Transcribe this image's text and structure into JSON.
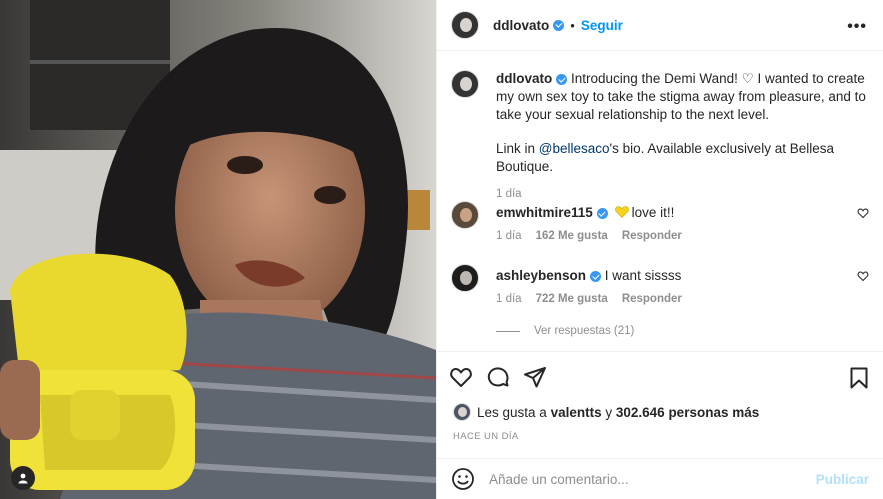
{
  "post": {
    "author": "ddlovato",
    "follow_label": "Seguir",
    "separator": "•",
    "caption_text": "Introducing the Demi Wand! ♡ I wanted to create my own sex toy to take the stigma away from pleasure, and to take your sexual relationship to the next level.",
    "caption_link_prefix": "Link in ",
    "caption_mention": "@bellesaco",
    "caption_link_suffix": "'s bio. Available exclusively at Bellesa Boutique.",
    "caption_time": "1 día"
  },
  "comments": [
    {
      "user": "emwhitmire115",
      "text": "love it!!",
      "emoji": "yellow-heart",
      "time": "1 día",
      "likes": "162 Me gusta",
      "reply": "Responder"
    },
    {
      "user": "ashleybenson",
      "text": "I want sissss",
      "time": "1 día",
      "likes": "722 Me gusta",
      "reply": "Responder"
    }
  ],
  "view_replies": "Ver respuestas (21)",
  "likes_line": {
    "prefix": "Les gusta a ",
    "user": "valentts",
    "middle": " y ",
    "count": "302.646 personas más"
  },
  "posted_ago": "HACE UN DÍA",
  "add_comment": {
    "placeholder": "Añade un comentario...",
    "publish_label": "Publicar"
  },
  "colors": {
    "accent": "#0095f6",
    "verified": "#3897f0",
    "publish_disabled": "#b2dffc",
    "case_yellow": "#f1e23a"
  }
}
